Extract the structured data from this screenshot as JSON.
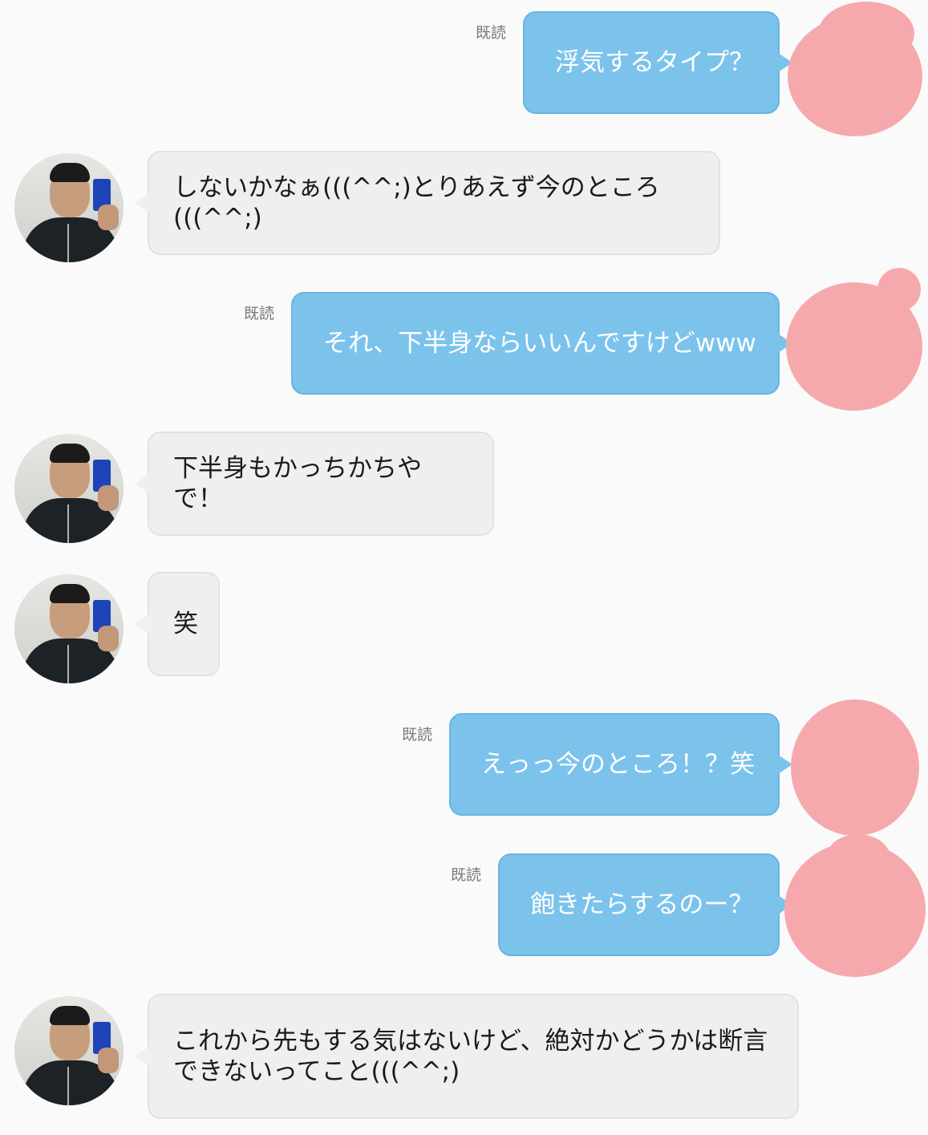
{
  "colors": {
    "outgoing_bubble": "#7cc3ec",
    "incoming_bubble": "#efefed",
    "background": "#fafafa",
    "privacy_blob": "#f6a9ad"
  },
  "messages": [
    {
      "direction": "outgoing",
      "read_label": "既読",
      "text": "浮気するタイプ？"
    },
    {
      "direction": "incoming",
      "text": "しないかなぁ(((^^;)とりあえず今のところ(((^^;)"
    },
    {
      "direction": "outgoing",
      "read_label": "既読",
      "text": "それ、下半身ならいいんですけどwww"
    },
    {
      "direction": "incoming",
      "text": "下半身もかっちかちやで！"
    },
    {
      "direction": "incoming",
      "text": "笑"
    },
    {
      "direction": "outgoing",
      "read_label": "既読",
      "text": "えっっ今のところ！？笑"
    },
    {
      "direction": "outgoing",
      "read_label": "既読",
      "text": "飽きたらするのー？"
    },
    {
      "direction": "incoming",
      "text": "これから先もする気はないけど、絶対かどうかは断言\nできないってこと(((^^;)"
    }
  ]
}
